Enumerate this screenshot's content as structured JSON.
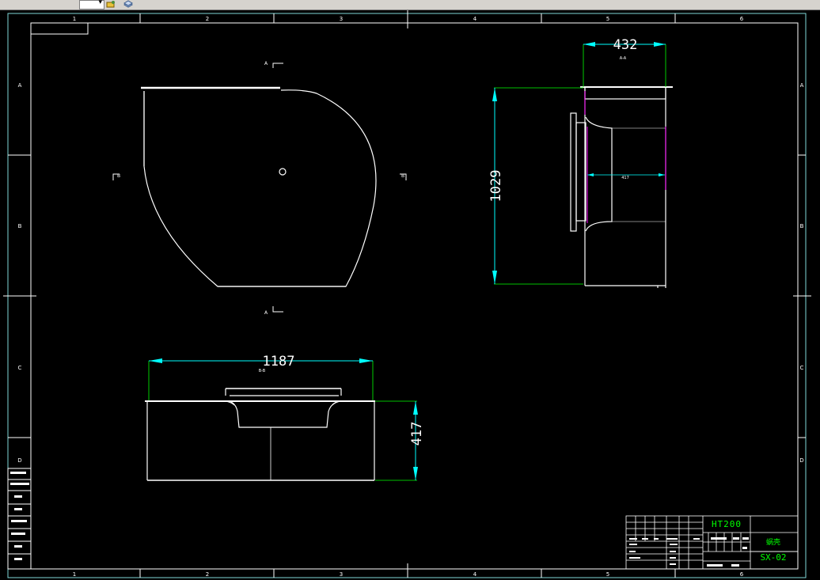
{
  "toolbar": {
    "icons": [
      "layer-tool-icon",
      "layer-states-icon"
    ]
  },
  "frame": {
    "col_labels": [
      "1",
      "2",
      "3",
      "4",
      "5",
      "6"
    ],
    "row_labels": [
      "A",
      "B",
      "C",
      "D"
    ]
  },
  "views": {
    "front": {
      "section_labels": [
        "A",
        "A",
        "B",
        "B"
      ]
    },
    "side": {
      "dim_width": "432",
      "dim_width_note": "A-A",
      "dim_height": "1029",
      "dim_inner": "417"
    },
    "top": {
      "dim_length": "1187",
      "dim_length_note": "B-B",
      "dim_height": "417"
    }
  },
  "title_block": {
    "material": "HT200",
    "part_name": "蜗壳",
    "drawing_no": "SX-02"
  },
  "colors": {
    "background": "#000000",
    "frame": "#ffffff",
    "dimension": "#00ffff",
    "extension": "#00ff00",
    "geometry": "#ffffff",
    "accent": "#ff00ff",
    "border_cyan": "#7fd8d8"
  }
}
